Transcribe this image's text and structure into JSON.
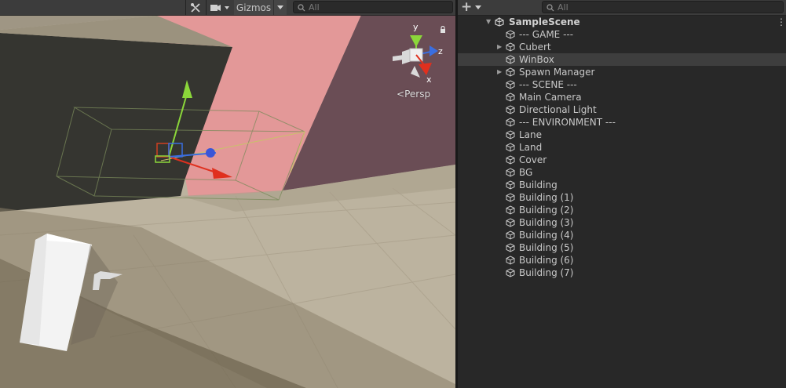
{
  "scene_view": {
    "toolbar": {
      "tools_icon": "tools-icon",
      "camera_icon": "camera-icon",
      "gizmos_label": "Gizmos",
      "search_placeholder": "All"
    },
    "orientation_gizmo": {
      "y_label": "y",
      "z_label": "z",
      "x_label": "x",
      "projection_label": "Persp"
    },
    "colors": {
      "sky": "#3f3b38",
      "pink_wall": "#e39898",
      "floor": "#bcb39f",
      "axis_y": "#8bd63a",
      "axis_x": "#e0301e",
      "axis_z": "#3a6ee0"
    }
  },
  "hierarchy": {
    "toolbar": {
      "add_label": "+",
      "search_placeholder": "All"
    },
    "scene_name": "SampleScene",
    "items": [
      {
        "label": "--- GAME ---",
        "expandable": false,
        "selected": false
      },
      {
        "label": "Cubert",
        "expandable": true,
        "selected": false
      },
      {
        "label": "WinBox",
        "expandable": false,
        "selected": true
      },
      {
        "label": "Spawn Manager",
        "expandable": true,
        "selected": false
      },
      {
        "label": "--- SCENE ---",
        "expandable": false,
        "selected": false
      },
      {
        "label": "Main Camera",
        "expandable": false,
        "selected": false
      },
      {
        "label": "Directional Light",
        "expandable": false,
        "selected": false
      },
      {
        "label": "--- ENVIRONMENT ---",
        "expandable": false,
        "selected": false
      },
      {
        "label": "Lane",
        "expandable": false,
        "selected": false
      },
      {
        "label": "Land",
        "expandable": false,
        "selected": false
      },
      {
        "label": "Cover",
        "expandable": false,
        "selected": false
      },
      {
        "label": "BG",
        "expandable": false,
        "selected": false
      },
      {
        "label": "Building",
        "expandable": false,
        "selected": false
      },
      {
        "label": "Building (1)",
        "expandable": false,
        "selected": false
      },
      {
        "label": "Building (2)",
        "expandable": false,
        "selected": false
      },
      {
        "label": "Building (3)",
        "expandable": false,
        "selected": false
      },
      {
        "label": "Building (4)",
        "expandable": false,
        "selected": false
      },
      {
        "label": "Building (5)",
        "expandable": false,
        "selected": false
      },
      {
        "label": "Building (6)",
        "expandable": false,
        "selected": false
      },
      {
        "label": "Building (7)",
        "expandable": false,
        "selected": false
      }
    ]
  }
}
